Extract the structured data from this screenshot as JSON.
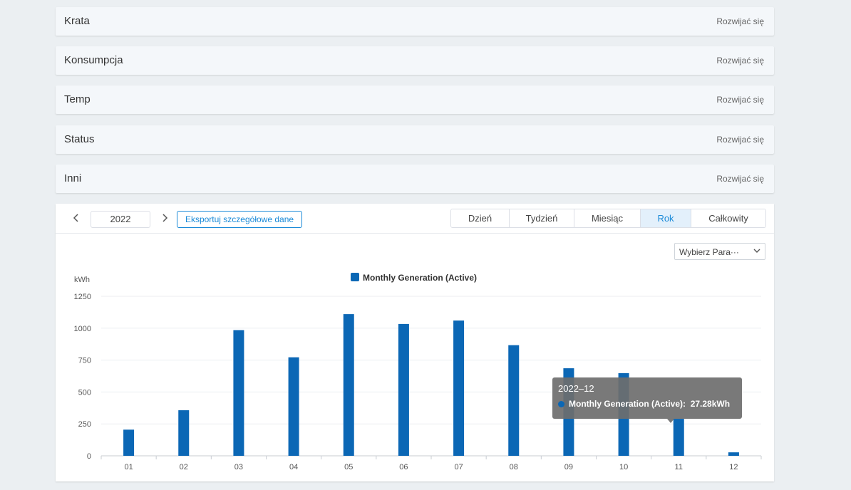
{
  "sections": [
    {
      "title": "Krata",
      "action": "Rozwijać się"
    },
    {
      "title": "Konsumpcja",
      "action": "Rozwijać się"
    },
    {
      "title": "Temp",
      "action": "Rozwijać się"
    },
    {
      "title": "Status",
      "action": "Rozwijać się"
    },
    {
      "title": "Inni",
      "action": "Rozwijać się"
    }
  ],
  "toolbar": {
    "prev_icon": "chevron-left-icon",
    "next_icon": "chevron-right-icon",
    "year": "2022",
    "export_label": "Eksportuj szczegółowe dane"
  },
  "tabs": [
    {
      "label": "Dzień",
      "active": false
    },
    {
      "label": "Tydzień",
      "active": false
    },
    {
      "label": "Miesiąc",
      "active": false
    },
    {
      "label": "Rok",
      "active": true
    },
    {
      "label": "Całkowity",
      "active": false
    }
  ],
  "param_select": {
    "value": "Wybierz Para···",
    "icon": "chevron-down-icon"
  },
  "tooltip": {
    "title": "2022–12",
    "label": "Monthly Generation (Active):",
    "value": "27.28kWh"
  },
  "colors": {
    "bar": "#0b67b5",
    "accent": "#1a8ad8"
  },
  "chart_data": {
    "type": "bar",
    "ylabel": "kWh",
    "ylim": [
      0,
      1250
    ],
    "yticks": [
      0,
      250,
      500,
      750,
      1000,
      1250
    ],
    "legend": "top-center",
    "grid": true,
    "categories": [
      "01",
      "02",
      "03",
      "04",
      "05",
      "06",
      "07",
      "08",
      "09",
      "10",
      "11",
      "12"
    ],
    "series": [
      {
        "name": "Monthly Generation (Active)",
        "values": [
          205,
          357,
          985,
          772,
          1110,
          1033,
          1060,
          867,
          686,
          648,
          290,
          27.28
        ]
      }
    ]
  }
}
